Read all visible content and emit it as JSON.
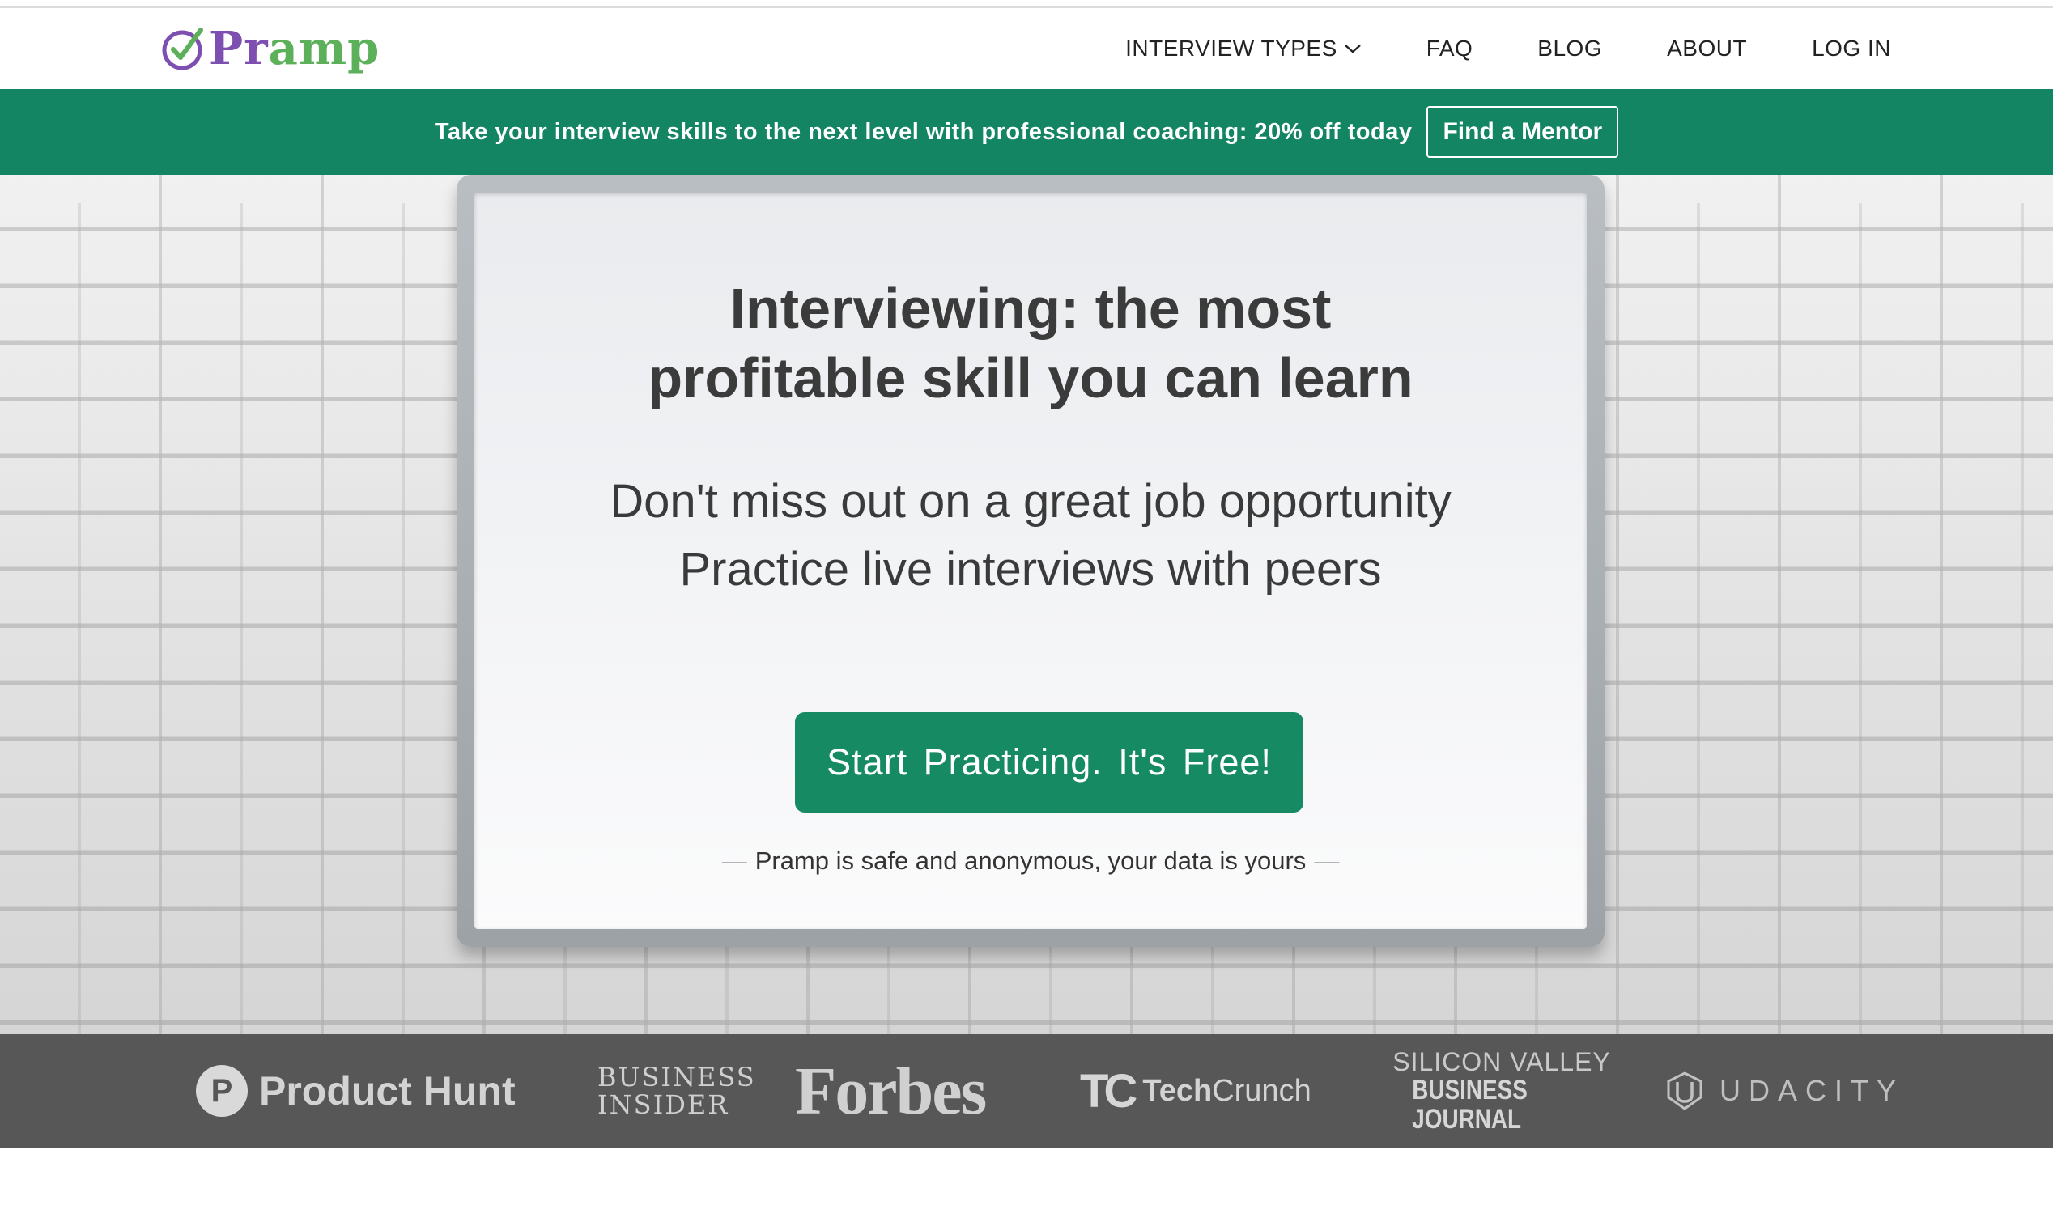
{
  "brand": {
    "name_part1": "Pr",
    "name_part2": "amp",
    "accent_color": "#148563",
    "logo_purple": "#7d4fb0",
    "logo_green": "#5cb05a"
  },
  "nav": {
    "items": [
      {
        "label": "INTERVIEW TYPES",
        "icon": "chevron-down-icon"
      },
      {
        "label": "FAQ"
      },
      {
        "label": "BLOG"
      },
      {
        "label": "ABOUT"
      },
      {
        "label": "LOG IN"
      }
    ]
  },
  "promo": {
    "text": "Take your interview skills to the next level with professional coaching: 20% off today",
    "button_label": "Find a Mentor"
  },
  "hero": {
    "title_line1": "Interviewing: the most",
    "title_line2": "profitable skill you can learn",
    "sub_line1": "Don't miss out on a great job opportunity",
    "sub_line2": "Practice live interviews with peers",
    "cta_label": "Start  Practicing.  It's  Free!",
    "safe_note": "Pramp is safe and anonymous, your data is yours",
    "safe_dash": "—"
  },
  "press": {
    "product_hunt_letter": "P",
    "product_hunt": "Product Hunt",
    "business_insider_l1": "BUSINESS",
    "business_insider_l2": "INSIDER",
    "forbes": "Forbes",
    "techcrunch_logo": "TC",
    "techcrunch_part1": "Tech",
    "techcrunch_part2": "Crunch",
    "svbj_l1": "SILICON VALLEY",
    "svbj_l2": "BUSINESS JOURNAL",
    "udacity": "UDACITY"
  }
}
